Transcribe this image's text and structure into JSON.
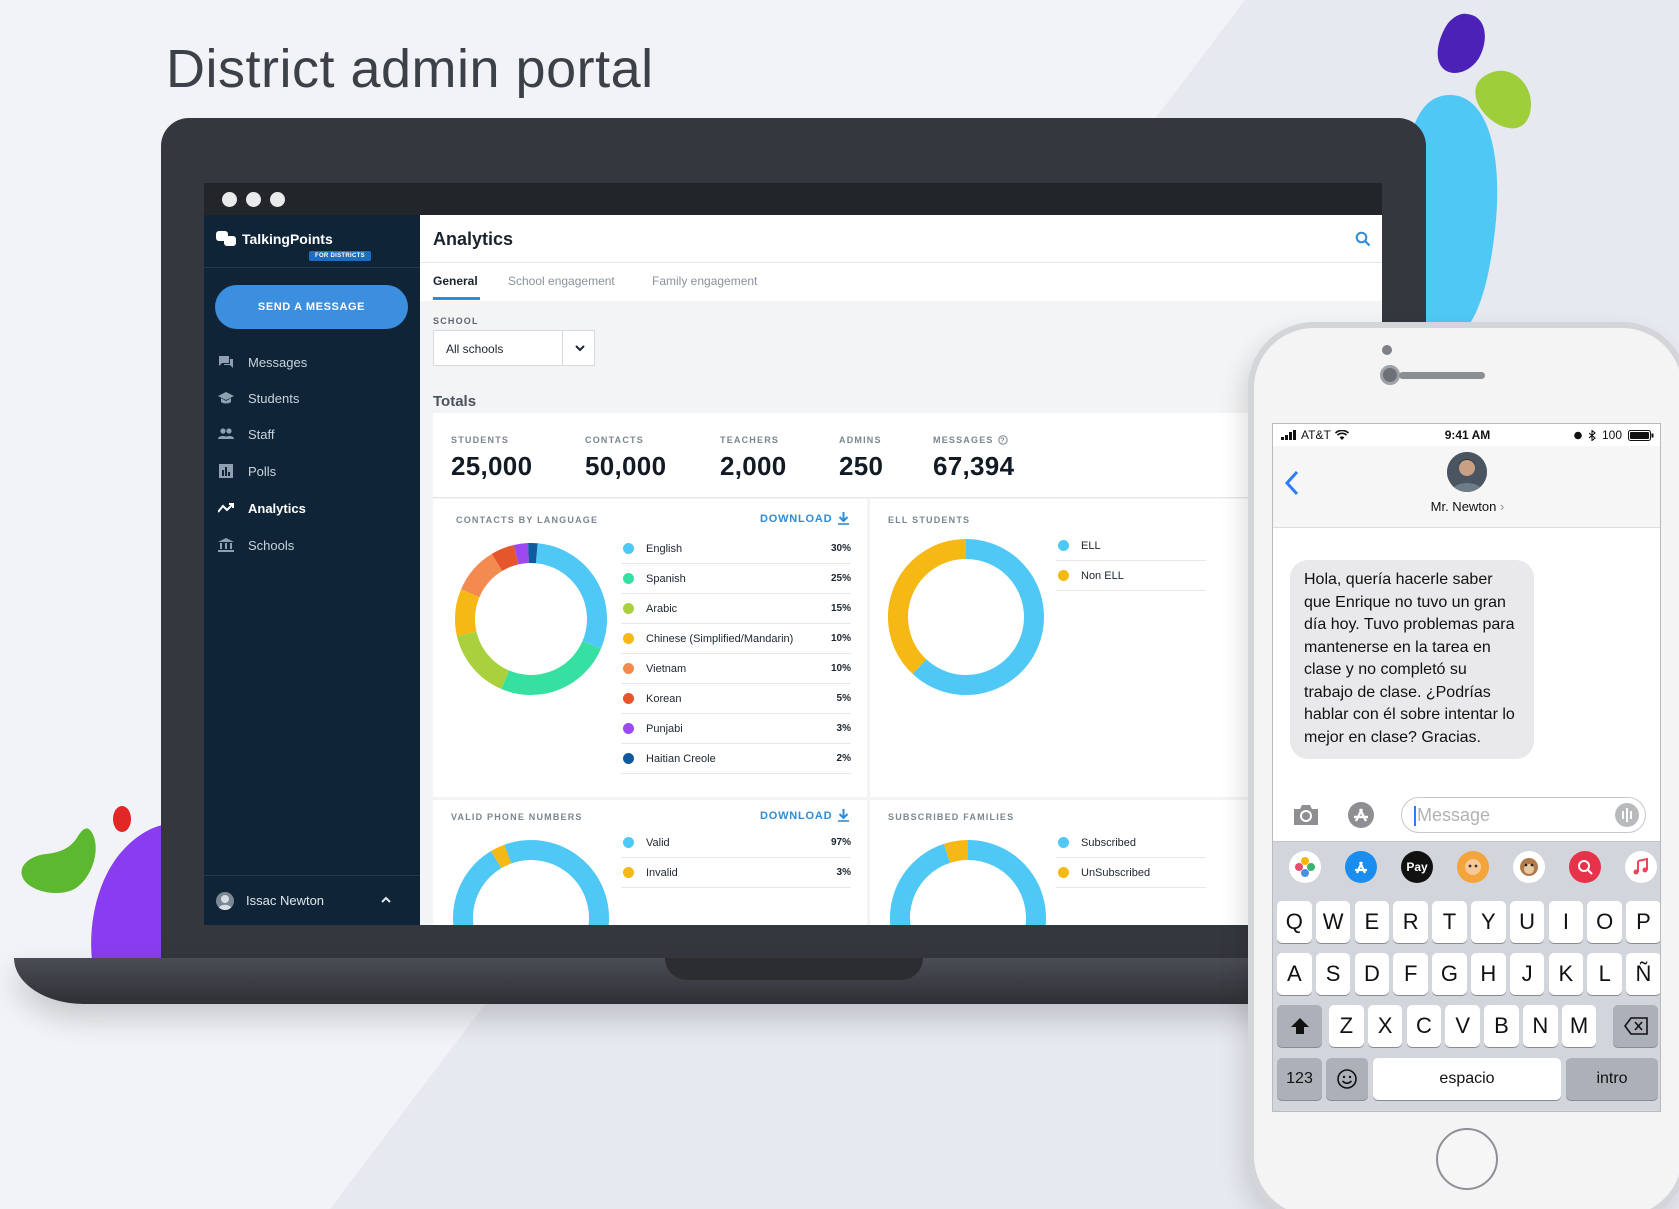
{
  "page_title": "District admin portal",
  "colors": {
    "sidebar_bg": "#0f2537",
    "accent": "#3c8ede",
    "purple_blob": "#4b21b8",
    "green_blob": "#9ecf3a",
    "cyan_blob": "#50c8f6"
  },
  "app": {
    "brand": "TalkingPoints",
    "brand_badge": "FOR DISTRICTS",
    "send_button": "SEND A MESSAGE",
    "nav": [
      {
        "label": "Messages",
        "icon": "messages-icon"
      },
      {
        "label": "Students",
        "icon": "graduation-cap-icon"
      },
      {
        "label": "Staff",
        "icon": "people-icon"
      },
      {
        "label": "Polls",
        "icon": "poll-icon"
      },
      {
        "label": "Analytics",
        "icon": "analytics-icon",
        "active": true
      },
      {
        "label": "Schools",
        "icon": "school-building-icon"
      }
    ],
    "user_name": "Issac Newton"
  },
  "main": {
    "title": "Analytics",
    "tabs": [
      "General",
      "School engagement",
      "Family engagement"
    ],
    "active_tab": "General",
    "school_label": "SCHOOL",
    "school_value": "All schools",
    "totals_label": "Totals",
    "totals": [
      {
        "label": "STUDENTS",
        "value": "25,000"
      },
      {
        "label": "CONTACTS",
        "value": "50,000"
      },
      {
        "label": "TEACHERS",
        "value": "2,000"
      },
      {
        "label": "ADMINS",
        "value": "250"
      },
      {
        "label": "MESSAGES",
        "value": "67,394"
      }
    ],
    "download_label": "DOWNLOAD"
  },
  "chart_data": [
    {
      "type": "pie",
      "title": "CONTACTS BY LANGUAGE",
      "categories": [
        "English",
        "Spanish",
        "Arabic",
        "Chinese (Simplified/Mandarin)",
        "Vietnam",
        "Korean",
        "Punjabi",
        "Haitian Creole"
      ],
      "values": [
        30,
        25,
        15,
        10,
        10,
        5,
        3,
        2
      ],
      "labels": [
        "30%",
        "25%",
        "15%",
        "10%",
        "10%",
        "5%",
        "3%",
        "2%"
      ],
      "colors": [
        "#4fc8f5",
        "#35e0a1",
        "#a9d13e",
        "#f6b812",
        "#f38b51",
        "#e5562c",
        "#9b4af0",
        "#0e5aa0"
      ]
    },
    {
      "type": "pie",
      "title": "ELL STUDENTS",
      "categories": [
        "ELL",
        "Non ELL"
      ],
      "values": [
        62,
        38
      ],
      "colors": [
        "#4fc8f5",
        "#f6b812"
      ]
    },
    {
      "type": "pie",
      "title": "VALID PHONE NUMBERS",
      "categories": [
        "Valid",
        "Invalid"
      ],
      "values": [
        97,
        3
      ],
      "labels": [
        "97%",
        "3%"
      ],
      "colors": [
        "#4fc8f5",
        "#f6b812"
      ]
    },
    {
      "type": "pie",
      "title": "SUBSCRIBED FAMILIES",
      "categories": [
        "Subscribed",
        "UnSubscribed"
      ],
      "values": [
        95,
        5
      ],
      "colors": [
        "#4fc8f5",
        "#f6b812"
      ]
    }
  ],
  "phone": {
    "carrier": "AT&T",
    "time": "9:41 AM",
    "battery": "100",
    "contact_name": "Mr. Newton",
    "contact_chevron": "›",
    "message": "Hola, quería hacerle saber que Enrique no tuvo un gran día hoy. Tuvo problemas para mantenerse en la tarea en clase y no completó su trabajo de clase. ¿Podrías hablar con él sobre intentar lo mejor en clase? Gracias.",
    "input_placeholder": "Message",
    "keyboard": {
      "row1": [
        "Q",
        "W",
        "E",
        "R",
        "T",
        "Y",
        "U",
        "I",
        "O",
        "P"
      ],
      "row2": [
        "A",
        "S",
        "D",
        "F",
        "G",
        "H",
        "J",
        "K",
        "L",
        "Ñ"
      ],
      "row3": [
        "Z",
        "X",
        "C",
        "V",
        "B",
        "N",
        "M"
      ],
      "numbers_key": "123",
      "space_key": "espacio",
      "return_key": "intro"
    },
    "apple_pay_label": "Pay"
  }
}
